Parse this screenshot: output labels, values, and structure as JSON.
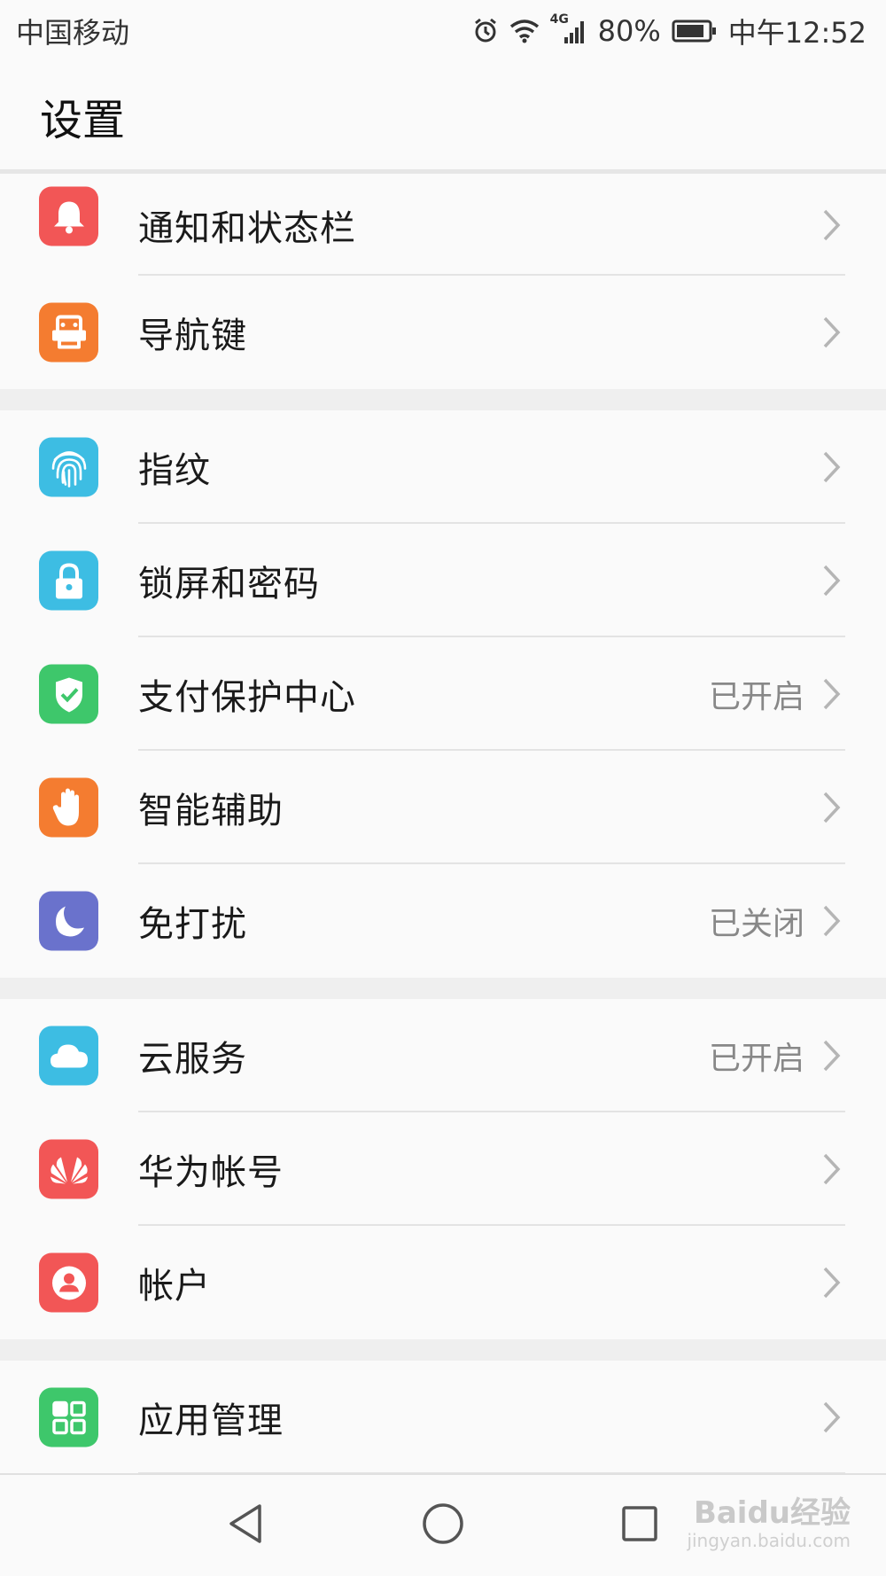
{
  "status_bar": {
    "carrier": "中国移动",
    "network": "4G",
    "battery": "80%",
    "time": "中午12:52"
  },
  "header": {
    "title": "设置"
  },
  "groups": [
    {
      "items": [
        {
          "label": "通知和状态栏",
          "icon": "bell-icon",
          "color": "#f25656"
        },
        {
          "label": "导航键",
          "icon": "navigation-key-icon",
          "color": "#f47c30"
        }
      ]
    },
    {
      "items": [
        {
          "label": "指纹",
          "icon": "fingerprint-icon",
          "color": "#3dbde3"
        },
        {
          "label": "锁屏和密码",
          "icon": "lock-icon",
          "color": "#3dbde3"
        },
        {
          "label": "支付保护中心",
          "icon": "shield-check-icon",
          "color": "#3ec76b",
          "status": "已开启"
        },
        {
          "label": "智能辅助",
          "icon": "hand-icon",
          "color": "#f47c30"
        },
        {
          "label": "免打扰",
          "icon": "moon-icon",
          "color": "#6a72cc",
          "status": "已关闭"
        }
      ]
    },
    {
      "items": [
        {
          "label": "云服务",
          "icon": "cloud-icon",
          "color": "#3dbde3",
          "status": "已开启"
        },
        {
          "label": "华为帐号",
          "icon": "huawei-logo-icon",
          "color": "#f25656"
        },
        {
          "label": "帐户",
          "icon": "account-icon",
          "color": "#f25656"
        }
      ]
    },
    {
      "items": [
        {
          "label": "应用管理",
          "icon": "apps-grid-icon",
          "color": "#3ec76b"
        }
      ]
    }
  ],
  "watermark": {
    "text": "Baidu经验",
    "sub": "jingyan.baidu.com"
  }
}
